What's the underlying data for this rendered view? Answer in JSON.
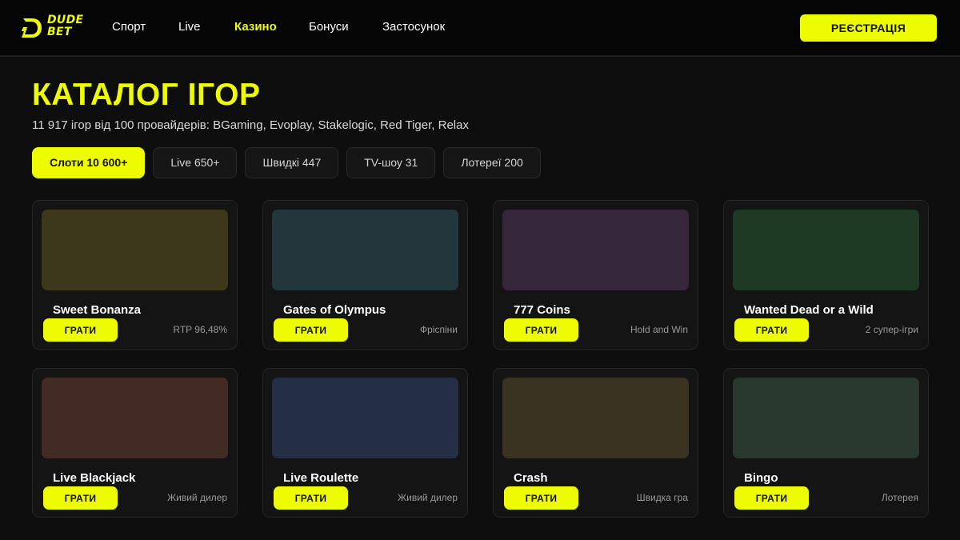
{
  "header": {
    "logo_line1": "DUDE",
    "logo_line2": "BET",
    "nav": [
      "Спорт",
      "Live",
      "Казино",
      "Бонуси",
      "Застосунок"
    ],
    "active_nav": "Казино",
    "register_label": "РЕЄСТРАЦІЯ"
  },
  "catalog": {
    "title": "КАТАЛОГ ІГОР",
    "subtitle": "11 917 ігор від 100 провайдерів: BGaming, Evoplay, Stakelogic, Red Tiger, Relax",
    "filters": [
      "Слоти 10 600+",
      "Live 650+",
      "Швидкі 447",
      "TV-шоу 31",
      "Лотереї 200"
    ],
    "active_filter": "Слоти 10 600+"
  },
  "games": [
    {
      "title": "Sweet Bonanza",
      "meta": "RTP 96,48%",
      "play_label": "ГРАТИ",
      "color": "#3d381b"
    },
    {
      "title": "Gates of Olympus",
      "meta": "Фріспіни",
      "play_label": "ГРАТИ",
      "color": "#22363b"
    },
    {
      "title": "777 Coins",
      "meta": "Hold and Win",
      "play_label": "ГРАТИ",
      "color": "#36263a"
    },
    {
      "title": "Wanted Dead or a Wild",
      "meta": "2 супер-ігри",
      "play_label": "ГРАТИ",
      "color": "#1f3a24"
    },
    {
      "title": "Live Blackjack",
      "meta": "Живий дилер",
      "play_label": "ГРАТИ",
      "color": "#412b23"
    },
    {
      "title": "Live Roulette",
      "meta": "Живий дилер",
      "play_label": "ГРАТИ",
      "color": "#242f45"
    },
    {
      "title": "Crash",
      "meta": "Швидка гра",
      "play_label": "ГРАТИ",
      "color": "#3b3322"
    },
    {
      "title": "Bingo",
      "meta": "Лотерея",
      "play_label": "ГРАТИ",
      "color": "#28382f"
    }
  ],
  "colors": {
    "accent": "#eefc02",
    "background": "#0e0e0e",
    "header_bg": "#050505",
    "card_bg": "#141414"
  }
}
